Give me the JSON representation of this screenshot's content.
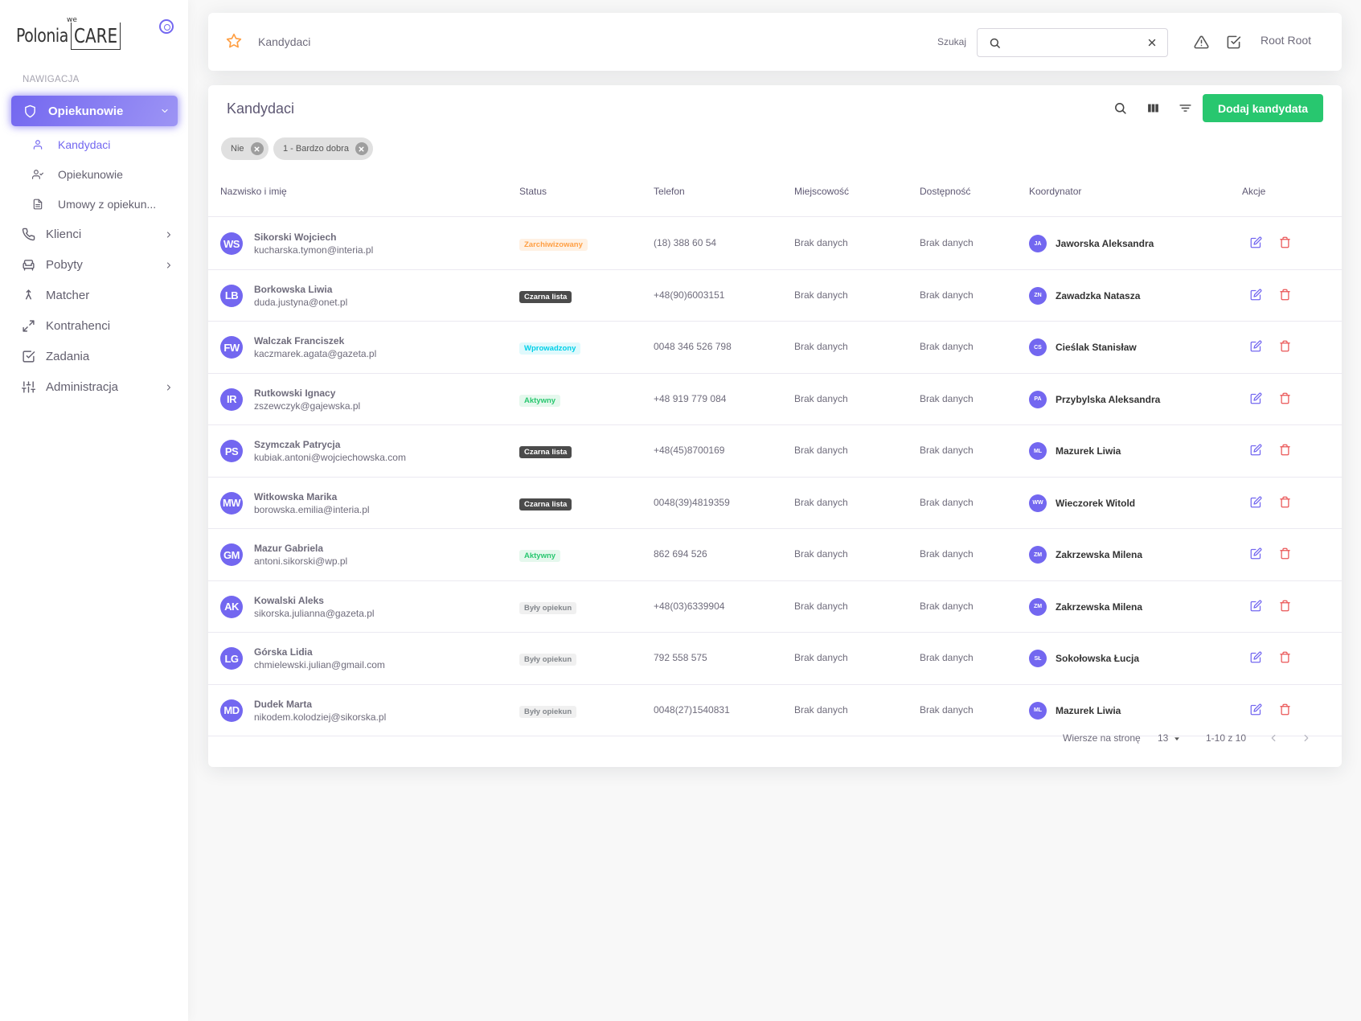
{
  "brand": {
    "we": "we",
    "polonia": "Polonia",
    "care": "CARE"
  },
  "sidebar": {
    "header": "NAWIGACJA",
    "active_group": {
      "label": "Opiekunowie",
      "icon": "shield-icon"
    },
    "sub_items": [
      {
        "label": "Kandydaci",
        "icon": "user-icon",
        "active": true
      },
      {
        "label": "Opiekunowie",
        "icon": "user-check-icon",
        "active": false
      },
      {
        "label": "Umowy z opiekun...",
        "icon": "file-icon",
        "active": false
      }
    ],
    "items": [
      {
        "label": "Klienci",
        "icon": "phone-icon",
        "chevron": true
      },
      {
        "label": "Pobyty",
        "icon": "armchair-icon",
        "chevron": true
      },
      {
        "label": "Matcher",
        "icon": "merge-icon",
        "chevron": false
      },
      {
        "label": "Kontrahenci",
        "icon": "arrows-diagonal-icon",
        "chevron": false
      },
      {
        "label": "Zadania",
        "icon": "check-square-icon",
        "chevron": false
      },
      {
        "label": "Administracja",
        "icon": "sliders-icon",
        "chevron": true
      }
    ]
  },
  "topbar": {
    "breadcrumb": "Kandydaci",
    "search_label": "Szukaj",
    "search_value": "",
    "user": "Root Root"
  },
  "card": {
    "title": "Kandydaci",
    "add_button": "Dodaj kandydata",
    "chips": [
      "Nie",
      "1 - Bardzo dobra"
    ],
    "columns": [
      "Nazwisko i imię",
      "Status",
      "Telefon",
      "Miejscowość",
      "Dostępność",
      "Koordynator",
      "Akcje"
    ],
    "rows": [
      {
        "initials": "WS",
        "name": "Sikorski Wojciech",
        "email": "kucharska.tymon@interia.pl",
        "status": "Zarchiwizowany",
        "status_type": "archived",
        "phone": "(18) 388 60 54",
        "city": "Brak danych",
        "availability": "Brak danych",
        "coord_initials": "JA",
        "coordinator": "Jaworska Aleksandra"
      },
      {
        "initials": "LB",
        "name": "Borkowska Liwia",
        "email": "duda.justyna@onet.pl",
        "status": "Czarna lista",
        "status_type": "blacklist",
        "phone": "+48(90)6003151",
        "city": "Brak danych",
        "availability": "Brak danych",
        "coord_initials": "ZN",
        "coordinator": "Zawadzka Natasza"
      },
      {
        "initials": "FW",
        "name": "Walczak Franciszek",
        "email": "kaczmarek.agata@gazeta.pl",
        "status": "Wprowadzony",
        "status_type": "entered",
        "phone": "0048 346 526 798",
        "city": "Brak danych",
        "availability": "Brak danych",
        "coord_initials": "CS",
        "coordinator": "Cieślak Stanisław"
      },
      {
        "initials": "IR",
        "name": "Rutkowski Ignacy",
        "email": "zszewczyk@gajewska.pl",
        "status": "Aktywny",
        "status_type": "active",
        "phone": "+48 919 779 084",
        "city": "Brak danych",
        "availability": "Brak danych",
        "coord_initials": "PA",
        "coordinator": "Przybylska Aleksandra"
      },
      {
        "initials": "PS",
        "name": "Szymczak Patrycja",
        "email": "kubiak.antoni@wojciechowska.com",
        "status": "Czarna lista",
        "status_type": "blacklist",
        "phone": "+48(45)8700169",
        "city": "Brak danych",
        "availability": "Brak danych",
        "coord_initials": "ML",
        "coordinator": "Mazurek Liwia"
      },
      {
        "initials": "MW",
        "name": "Witkowska Marika",
        "email": "borowska.emilia@interia.pl",
        "status": "Czarna lista",
        "status_type": "blacklist",
        "phone": "0048(39)4819359",
        "city": "Brak danych",
        "availability": "Brak danych",
        "coord_initials": "WW",
        "coordinator": "Wieczorek Witold"
      },
      {
        "initials": "GM",
        "name": "Mazur Gabriela",
        "email": "antoni.sikorski@wp.pl",
        "status": "Aktywny",
        "status_type": "active",
        "phone": "862 694 526",
        "city": "Brak danych",
        "availability": "Brak danych",
        "coord_initials": "ZM",
        "coordinator": "Zakrzewska Milena"
      },
      {
        "initials": "AK",
        "name": "Kowalski Aleks",
        "email": "sikorska.julianna@gazeta.pl",
        "status": "Były opiekun",
        "status_type": "former",
        "phone": "+48(03)6339904",
        "city": "Brak danych",
        "availability": "Brak danych",
        "coord_initials": "ZM",
        "coordinator": "Zakrzewska Milena"
      },
      {
        "initials": "LG",
        "name": "Górska Lidia",
        "email": "chmielewski.julian@gmail.com",
        "status": "Były opiekun",
        "status_type": "former",
        "phone": "792 558 575",
        "city": "Brak danych",
        "availability": "Brak danych",
        "coord_initials": "SŁ",
        "coordinator": "Sokołowska Łucja"
      },
      {
        "initials": "MD",
        "name": "Dudek Marta",
        "email": "nikodem.kolodziej@sikorska.pl",
        "status": "Były opiekun",
        "status_type": "former",
        "phone": "0048(27)1540831",
        "city": "Brak danych",
        "availability": "Brak danych",
        "coord_initials": "ML",
        "coordinator": "Mazurek Liwia"
      }
    ],
    "pagination": {
      "rows_label": "Wiersze na stronę",
      "per_page": "13",
      "range": "1-10 z 10"
    }
  },
  "colors": {
    "primary": "#7367f0",
    "success": "#28c76f",
    "danger": "#ea5455",
    "warning": "#ff9f43",
    "info": "#00cfe8",
    "dark": "#4b4b4b"
  }
}
